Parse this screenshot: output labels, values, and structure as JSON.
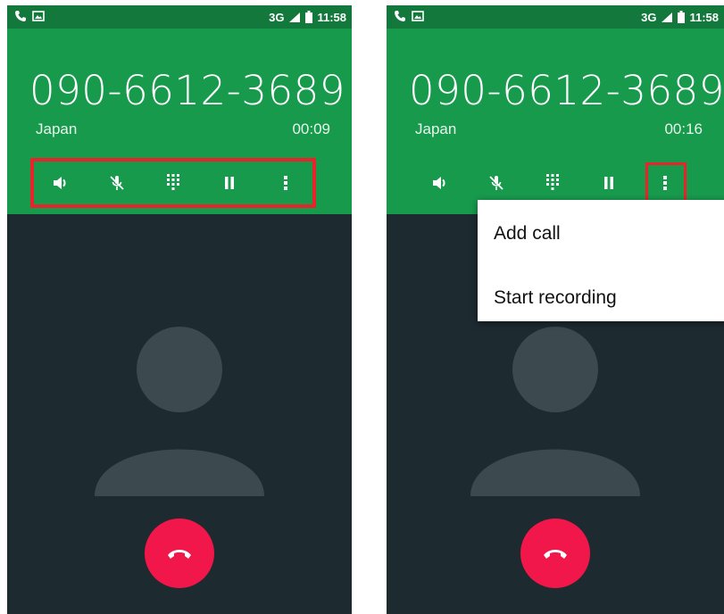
{
  "screens": [
    {
      "status": {
        "network": "3G",
        "time": "11:58"
      },
      "call": {
        "number": "090-6612-3689",
        "location": "Japan",
        "duration": "00:09"
      },
      "controls": [
        "speaker-icon",
        "mute-icon",
        "dialpad-icon",
        "hold-icon",
        "more-options-icon"
      ]
    },
    {
      "status": {
        "network": "3G",
        "time": "11:58"
      },
      "call": {
        "number": "090-6612-3689",
        "location": "Japan",
        "duration": "00:16"
      },
      "controls": [
        "speaker-icon",
        "mute-icon",
        "dialpad-icon",
        "hold-icon",
        "more-options-icon"
      ],
      "menu": {
        "items": [
          "Add call",
          "Start recording"
        ]
      }
    }
  ],
  "colors": {
    "status_bar": "#12783b",
    "header_green": "#189a4d",
    "call_background": "#1d2a30",
    "end_call_red": "#f2174a",
    "highlight_red": "#e8232b"
  }
}
